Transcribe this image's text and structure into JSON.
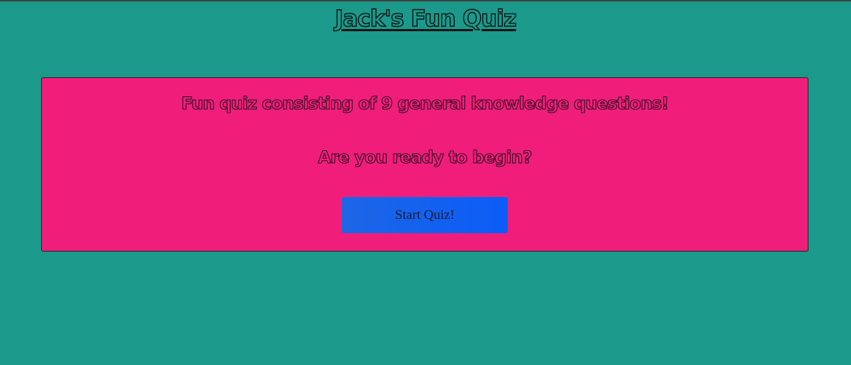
{
  "header": {
    "title": "Jack's Fun Quiz"
  },
  "main": {
    "intro": "Fun quiz consisting of 9 general knowledge questions!",
    "prompt": "Are you ready to begin?",
    "start_button_label": "Start Quiz!"
  },
  "colors": {
    "background": "#1b998b",
    "card": "#f01e7a",
    "button": "#0b5cf8"
  }
}
